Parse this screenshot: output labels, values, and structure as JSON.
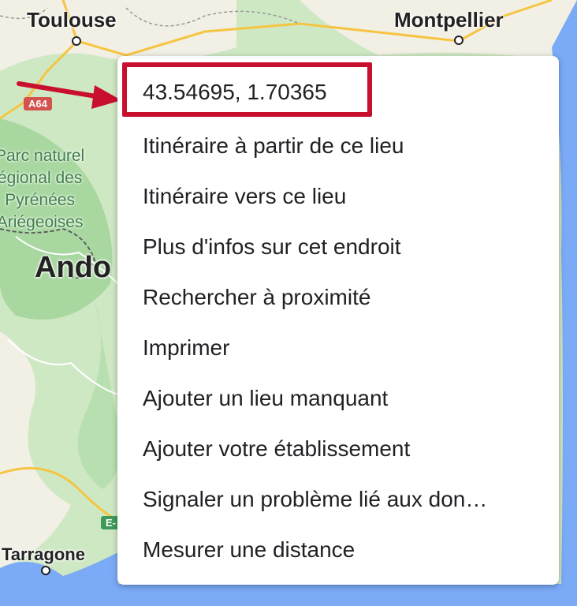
{
  "map": {
    "cities": [
      {
        "name": "Toulouse"
      },
      {
        "name": "Montpellier"
      },
      {
        "name": "Ando"
      },
      {
        "name": "Tarragone"
      }
    ],
    "park_label": "Parc naturel\négional des\nPyrénées\nAriégeoises",
    "road_badges": {
      "a64": "A64",
      "e": "E-"
    },
    "colors": {
      "land": "#cfe8c4",
      "sea": "#7baaf7",
      "highlight": "#c8102e"
    }
  },
  "context_menu": {
    "items": [
      "43.54695, 1.70365",
      "Itinéraire à partir de ce lieu",
      "Itinéraire vers ce lieu",
      "Plus d'infos sur cet endroit",
      "Rechercher à proximité",
      "Imprimer",
      "Ajouter un lieu manquant",
      "Ajouter votre établissement",
      "Signaler un problème lié aux don…",
      "Mesurer une distance"
    ]
  }
}
